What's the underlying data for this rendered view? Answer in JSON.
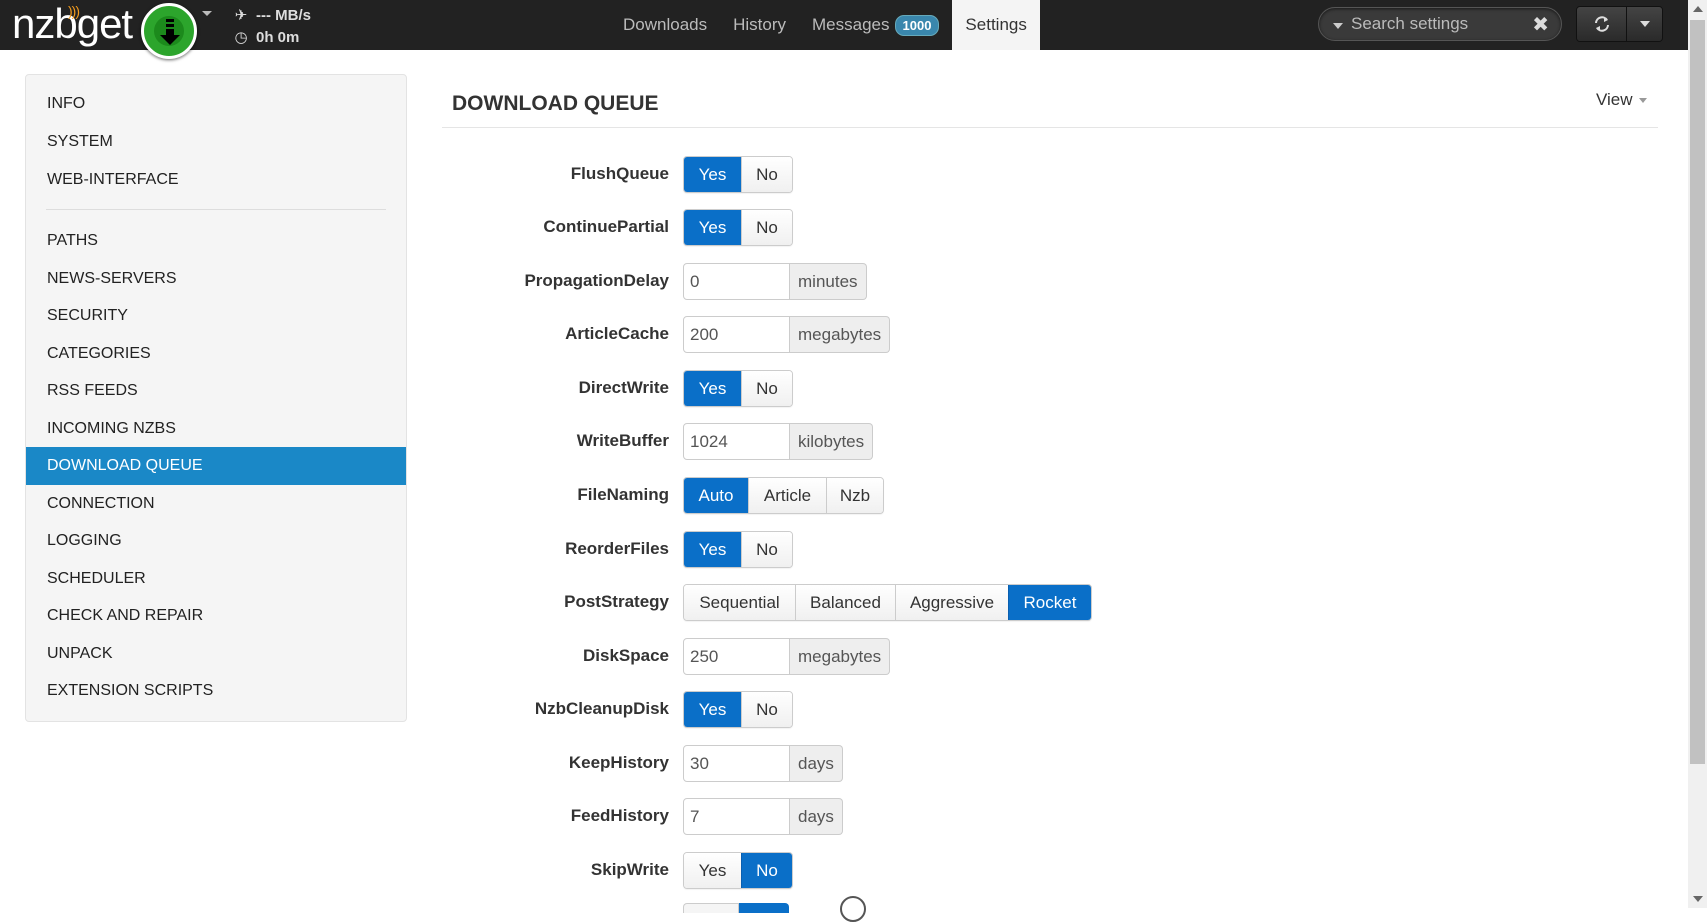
{
  "app": {
    "logo_text": "nzbget",
    "speed": "--- MB/s",
    "time_left": "0h 0m"
  },
  "nav": {
    "tabs": [
      {
        "label": "Downloads"
      },
      {
        "label": "History"
      },
      {
        "label": "Messages",
        "badge": "1000"
      },
      {
        "label": "Settings"
      }
    ],
    "active_tab": "Settings"
  },
  "search": {
    "placeholder": "Search settings"
  },
  "sidebar": {
    "items": [
      {
        "label": "INFO"
      },
      {
        "label": "SYSTEM"
      },
      {
        "label": "WEB-INTERFACE"
      },
      {
        "label": "PATHS"
      },
      {
        "label": "NEWS-SERVERS"
      },
      {
        "label": "SECURITY"
      },
      {
        "label": "CATEGORIES"
      },
      {
        "label": "RSS FEEDS"
      },
      {
        "label": "INCOMING NZBS"
      },
      {
        "label": "DOWNLOAD QUEUE"
      },
      {
        "label": "CONNECTION"
      },
      {
        "label": "LOGGING"
      },
      {
        "label": "SCHEDULER"
      },
      {
        "label": "CHECK AND REPAIR"
      },
      {
        "label": "UNPACK"
      },
      {
        "label": "EXTENSION SCRIPTS"
      }
    ],
    "active": "DOWNLOAD QUEUE"
  },
  "section": {
    "title": "DOWNLOAD QUEUE",
    "view_label": "View"
  },
  "options": [
    {
      "name": "FlushQueue",
      "type": "choice",
      "choices": [
        "Yes",
        "No"
      ],
      "selected": "Yes"
    },
    {
      "name": "ContinuePartial",
      "type": "choice",
      "choices": [
        "Yes",
        "No"
      ],
      "selected": "Yes"
    },
    {
      "name": "PropagationDelay",
      "type": "input",
      "value": "0",
      "unit": "minutes"
    },
    {
      "name": "ArticleCache",
      "type": "input",
      "value": "200",
      "unit": "megabytes"
    },
    {
      "name": "DirectWrite",
      "type": "choice",
      "choices": [
        "Yes",
        "No"
      ],
      "selected": "Yes"
    },
    {
      "name": "WriteBuffer",
      "type": "input",
      "value": "1024",
      "unit": "kilobytes"
    },
    {
      "name": "FileNaming",
      "type": "choice",
      "choices": [
        "Auto",
        "Article",
        "Nzb"
      ],
      "selected": "Auto"
    },
    {
      "name": "ReorderFiles",
      "type": "choice",
      "choices": [
        "Yes",
        "No"
      ],
      "selected": "Yes"
    },
    {
      "name": "PostStrategy",
      "type": "choice",
      "choices": [
        "Sequential",
        "Balanced",
        "Aggressive",
        "Rocket"
      ],
      "selected": "Rocket"
    },
    {
      "name": "DiskSpace",
      "type": "input",
      "value": "250",
      "unit": "megabytes"
    },
    {
      "name": "NzbCleanupDisk",
      "type": "choice",
      "choices": [
        "Yes",
        "No"
      ],
      "selected": "Yes"
    },
    {
      "name": "KeepHistory",
      "type": "input",
      "value": "30",
      "unit": "days"
    },
    {
      "name": "FeedHistory",
      "type": "input",
      "value": "7",
      "unit": "days"
    },
    {
      "name": "SkipWrite",
      "type": "choice",
      "choices": [
        "Yes",
        "No"
      ],
      "selected": "No"
    }
  ],
  "colors": {
    "navbar": "#222222",
    "accent": "#0a6fc8",
    "sidebar_active": "#1a88c7",
    "play_button": "#2ca52c"
  }
}
